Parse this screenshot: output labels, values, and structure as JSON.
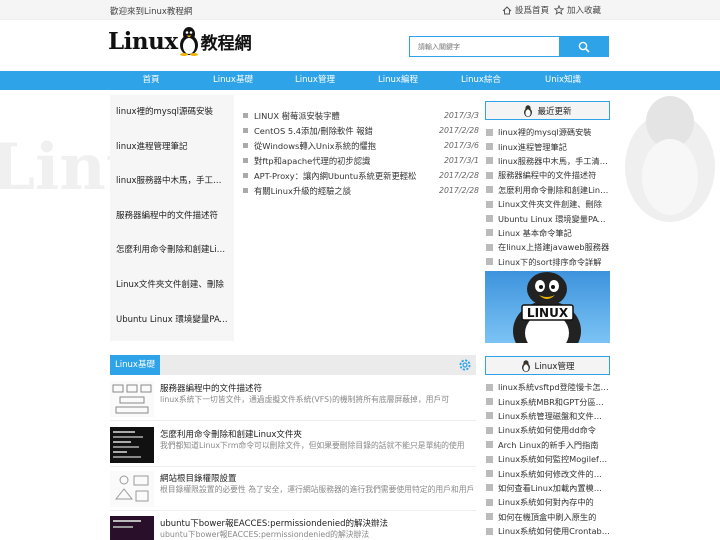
{
  "topbar": {
    "welcome": "歡迎來到Linux教程網",
    "homepage": "設爲首頁",
    "favorite": "加入收藏"
  },
  "logo": {
    "word": "Linux",
    "cn": "教程網"
  },
  "search": {
    "placeholder": "請輸入關鍵字"
  },
  "nav": [
    "首頁",
    "Linux基礎",
    "Linux管理",
    "Linux編程",
    "Linux綜合",
    "Unix知識"
  ],
  "left_list": [
    "linux裡的mysql源碼安裝",
    "linux進程管理筆記",
    "linux服務器中木馬，手工清除方法",
    "服務器編程中的文件描述符",
    "怎麼利用命令刪除和創建Linux文件夾",
    "Linux文件夾文件創建、刪除",
    "Ubuntu Linux 環境變量PATH設置"
  ],
  "news": [
    {
      "title": "LINUX 樹莓派安裝字體",
      "date": "2017/3/3"
    },
    {
      "title": "CentOS 5.4添加/刪除軟件 報錯",
      "date": "2017/2/28"
    },
    {
      "title": "從Windows轉入Unix系統的懼抱",
      "date": "2017/3/6"
    },
    {
      "title": "對ftp和apache代理的初步認識",
      "date": "2017/3/1"
    },
    {
      "title": "APT-Proxy：讓內網Ubuntu系統更新更輕松",
      "date": "2017/2/28"
    },
    {
      "title": "有關Linux升級的經驗之談",
      "date": "2017/2/28"
    }
  ],
  "latest": {
    "title": "最近更新",
    "items": [
      "linux裡的mysql源碼安裝",
      "linux進程管理筆記",
      "linux服務器中木馬，手工清除方法",
      "服務器編程中的文件描述符",
      "怎麼利用命令刪除和創建Linux文件夾",
      "Linux文件夾文件創建、刪除",
      "Ubuntu Linux 環境變量PATH設置",
      "Linux 基本命令筆記",
      "在linux上搭建javaweb服務器",
      "Linux下的sort排序命令詳解"
    ]
  },
  "banner": {
    "label": "LINUX"
  },
  "manage": {
    "title": "Linux管理",
    "items": [
      "linux系統vsftpd登陸慢卡怎麼辦",
      "Linux系統MBR和GPT分區的區別",
      "Linux系統管理磁盤和文件的方法",
      "Linux系統如何使用dd命令",
      "Arch Linux的新手入門指南",
      "Linux系統如何監控Mogilefs存儲",
      "Linux系統如何修改文件的時間",
      "如何查看Linux加載內置模塊的信息",
      "Linux系統如何對內存中的",
      "如何在機頂盒中刷入原生的",
      "Linux系統如何使用Crontab安排日"
    ]
  },
  "section": {
    "tab": "Linux基礎"
  },
  "articles": [
    {
      "title": "服務器編程中的文件描述符",
      "desc": "linux系統下一切皆文件，通過虛擬文件系統(VFS)的機制將所有底層屏蔽掉，用戶可"
    },
    {
      "title": "怎麼利用命令刪除和創建Linux文件夾",
      "desc": "我們都知道Linux下rm命令可以刪除文件，但如果要刪除目錄的話就不能只是單純的使用"
    },
    {
      "title": "網站根目錄權限設置",
      "desc": "根目錄權限設置的必要性 為了安全，運行網站服務器的進行我們需要使用特定的用戶和用戶"
    },
    {
      "title": "ubuntu下bower報EACCES:permissiondenied的解決辦法",
      "desc": "ubuntu下bower報EACCES:permissiondenied的解決辦法"
    }
  ],
  "colors": {
    "accent": "#2fa3e7"
  }
}
